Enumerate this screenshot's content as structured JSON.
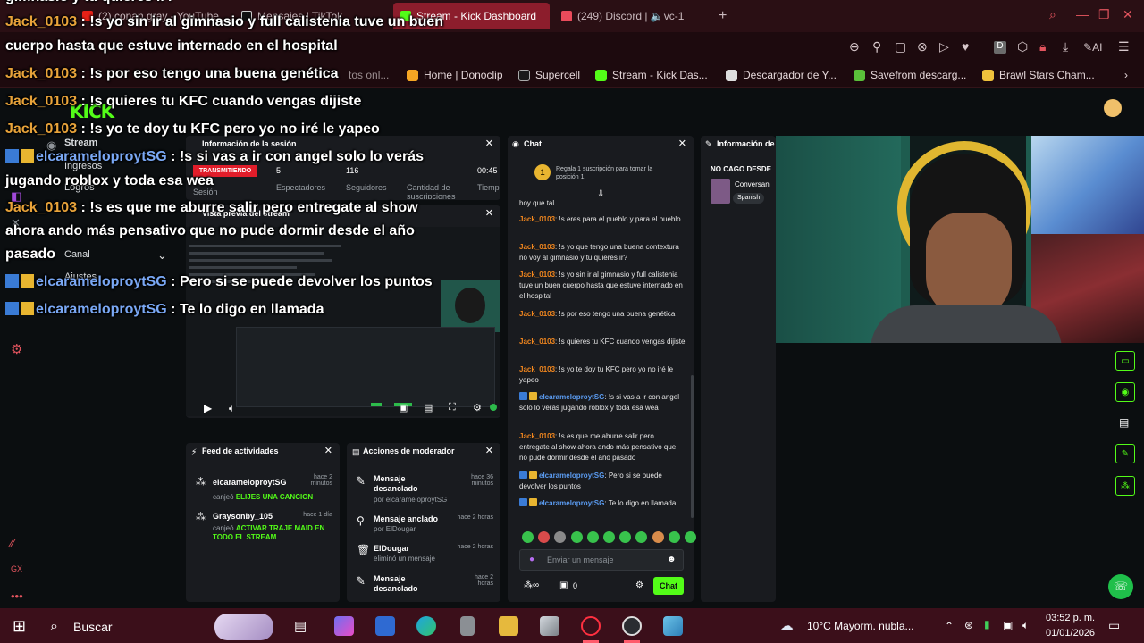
{
  "browser": {
    "tabs": [
      {
        "label": "(2) conan gray - YouTube"
      },
      {
        "label": "Mensajes | TikTok"
      },
      {
        "label": "Stream - Kick Dashboard"
      },
      {
        "label": "(249) Discord | 🔈vc-1"
      }
    ],
    "new_tab": "+",
    "bookmarks": [
      {
        "label": "Home | Donoclip"
      },
      {
        "label": "Supercell"
      },
      {
        "label": "Stream - Kick Das..."
      },
      {
        "label": "Descargador de Y..."
      },
      {
        "label": "Savefrom descarg..."
      },
      {
        "label": "Brawl Stars Cham..."
      }
    ],
    "bookmark_partial": "tos onl...",
    "ai_label": "AI",
    "colors": {
      "accent": "#53fc18",
      "tab_active": "#8c1d2c"
    }
  },
  "sidebar": {
    "logo": "KICK",
    "items": [
      {
        "label": "Stream"
      },
      {
        "label": "Ingresos"
      },
      {
        "label": "Logros"
      },
      {
        "label": "Canal"
      },
      {
        "label": "Ajustes"
      }
    ]
  },
  "session": {
    "title": "Información de la sesión",
    "live_badge": "TRANSMITIENDO",
    "viewers": "5",
    "followers": "116",
    "duration": "00:45",
    "labels": [
      "Sesión",
      "Espectadores",
      "Seguidores",
      "Cantidad de suscripciones",
      "Tiemp"
    ]
  },
  "preview": {
    "title": "Vista previa del stream"
  },
  "feed": {
    "title": "Feed de actividades",
    "items": [
      {
        "user": "elcarameloproytSG",
        "action": "canjeó",
        "reward": "ELIJES UNA CANCION",
        "time": "hace 2 minutos"
      },
      {
        "user": "Graysonby_105",
        "action": "canjeó",
        "reward": "ACTIVAR TRAJE MAID EN TODO EL STREAM",
        "time": "hace 1 día"
      }
    ]
  },
  "mod": {
    "title": "Acciones de moderador",
    "items": [
      {
        "action": "Mensaje desanclado",
        "by": "por elcarameloproytSG",
        "time": "hace 36 minutos"
      },
      {
        "action": "Mensaje anclado",
        "by": "por ElDougar",
        "time": "hace 2 horas"
      },
      {
        "action": "ElDougar",
        "by": "eliminó un mensaje",
        "time": "hace 2 horas"
      },
      {
        "action": "Mensaje desanclado",
        "by": "",
        "time": "hace 2 horas"
      }
    ]
  },
  "chat": {
    "title": "Chat",
    "gift_text": "Regala 1 suscripción para tomar la posición 1",
    "gift_rank": "1",
    "top_partial": "hoy que tal",
    "messages": [
      {
        "user": "Jack_0103",
        "type": "jack",
        "text": "!s eres para el pueblo y para el pueblo"
      },
      {
        "user": "Jack_0103",
        "type": "jack",
        "text": "!s yo que tengo una buena contextura no voy al gimnasio y tu quieres ir?"
      },
      {
        "user": "Jack_0103",
        "type": "jack",
        "text": "!s yo sin ir al gimnasio y full calistenia tuve un buen cuerpo hasta que estuve internado en el hospital"
      },
      {
        "user": "Jack_0103",
        "type": "jack",
        "text": "!s por eso tengo una buena genética"
      },
      {
        "user": "Jack_0103",
        "type": "jack",
        "text": "!s quieres tu KFC cuando vengas dijiste"
      },
      {
        "user": "Jack_0103",
        "type": "jack",
        "text": "!s yo te doy tu KFC pero yo no iré le yapeo"
      },
      {
        "user": "elcarameloproytSG",
        "type": "elc",
        "text": "!s si vas a ir con angel solo lo verás jugando roblox y toda esa wea"
      },
      {
        "user": "Jack_0103",
        "type": "jack",
        "text": "!s es que me aburre salir pero entregate al show ahora ando más pensativo que no pude dormir desde el año pasado"
      },
      {
        "user": "elcarameloproytSG",
        "type": "elc",
        "text": "Pero si se puede devolver los puntos"
      },
      {
        "user": "elcarameloproytSG",
        "type": "elc",
        "text": "Te lo digo en llamada"
      }
    ],
    "placeholder": "Enviar un mensaje",
    "points": "0",
    "send_label": "Chat"
  },
  "info_panel": {
    "title": "Información de",
    "stream_title": "NO CAGO DESDE",
    "category": "Conversan",
    "language": "Spanish"
  },
  "overlay": [
    {
      "user": "",
      "type": "none",
      "text": "gimnasio y tu quieres ir?"
    },
    {
      "user": "Jack_0103",
      "type": "jack",
      "text": "!s yo sin ir al gimnasio y full calistenia tuve un buen"
    },
    {
      "user": "",
      "type": "none",
      "text": "cuerpo hasta que estuve internado en el hospital"
    },
    {
      "user": "Jack_0103",
      "type": "jack",
      "text": "!s por eso tengo una buena genética"
    },
    {
      "user": "Jack_0103",
      "type": "jack",
      "text": "!s quieres tu KFC cuando vengas dijiste"
    },
    {
      "user": "Jack_0103",
      "type": "jack",
      "text": "!s yo te doy tu KFC pero yo no iré le yapeo"
    },
    {
      "user": "elcarameloproytSG",
      "type": "elc",
      "text": "!s si vas a ir con angel solo lo verás"
    },
    {
      "user": "",
      "type": "none",
      "text": "jugando roblox y toda esa wea"
    },
    {
      "user": "Jack_0103",
      "type": "jack",
      "text": "!s es que me aburre salir pero entregate al show"
    },
    {
      "user": "",
      "type": "none",
      "text": "ahora ando más pensativo que no pude dormir desde el año"
    },
    {
      "user": "",
      "type": "none",
      "text": "pasado"
    },
    {
      "user": "elcarameloproytSG",
      "type": "elc",
      "text": "Pero si se puede devolver los puntos"
    },
    {
      "user": "elcarameloproytSG",
      "type": "elc",
      "text": "Te lo digo en llamada"
    }
  ],
  "taskbar": {
    "search": "Buscar",
    "weather": "10°C  Mayorm. nubla...",
    "time": "03:52 p. m.",
    "date": "01/01/2026"
  }
}
